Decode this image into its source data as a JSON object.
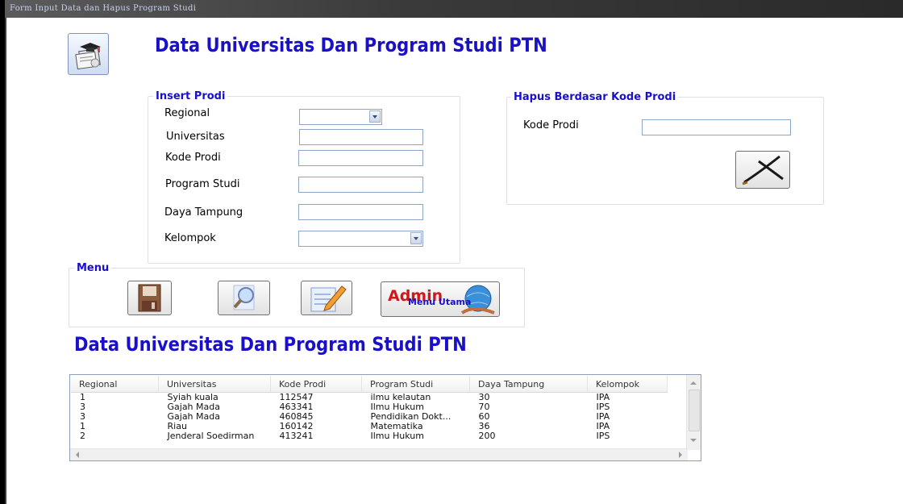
{
  "window": {
    "title": "Form Input Data dan Hapus Program Studi"
  },
  "header": {
    "title": "Data Universitas Dan Program Studi PTN",
    "icon": "graduation-document-icon"
  },
  "insert_prodi": {
    "legend": "Insert Prodi",
    "regional_label": "Regional",
    "regional_value": "",
    "universitas_label": "Universitas",
    "universitas_value": "",
    "kode_prodi_label": "Kode Prodi",
    "kode_prodi_value": "",
    "program_studi_label": "Program Studi",
    "program_studi_value": "",
    "daya_tampung_label": "Daya Tampung",
    "daya_tampung_value": "",
    "kelompok_label": "Kelompok",
    "kelompok_value": ""
  },
  "hapus": {
    "legend": "Hapus Berdasar Kode Prodi",
    "kode_prodi_label": "Kode Prodi",
    "kode_prodi_value": "",
    "delete_icon": "delete-x-icon"
  },
  "menu": {
    "legend": "Menu",
    "save_icon": "save-disk-icon",
    "search_icon": "magnifier-icon",
    "edit_icon": "edit-pencil-icon",
    "admin_image_text": "Admin",
    "menu_utama_label": "Menu Utama"
  },
  "section_title": "Data Universitas Dan Program Studi PTN",
  "table": {
    "columns": [
      "Regional",
      "Universitas",
      "Kode Prodi",
      "Program Studi",
      "Daya Tampung",
      "Kelompok"
    ],
    "rows": [
      [
        "1",
        "Syiah kuala",
        "112547",
        "ilmu kelautan",
        "30",
        "IPA"
      ],
      [
        "3",
        "Gajah Mada",
        "463341",
        "Ilmu Hukum",
        "70",
        "IPS"
      ],
      [
        "3",
        "Gajah Mada",
        "460845",
        "Pendidikan Dokt...",
        "60",
        "IPA"
      ],
      [
        "1",
        "Riau",
        "160142",
        "Matematika",
        "36",
        "IPA"
      ],
      [
        "2",
        "Jenderal Soedirman",
        "413241",
        "Ilmu Hukum",
        "200",
        "IPS"
      ]
    ]
  },
  "colors": {
    "heading_blue": "#1a10c8",
    "title_bar": "#3a3a3a"
  }
}
